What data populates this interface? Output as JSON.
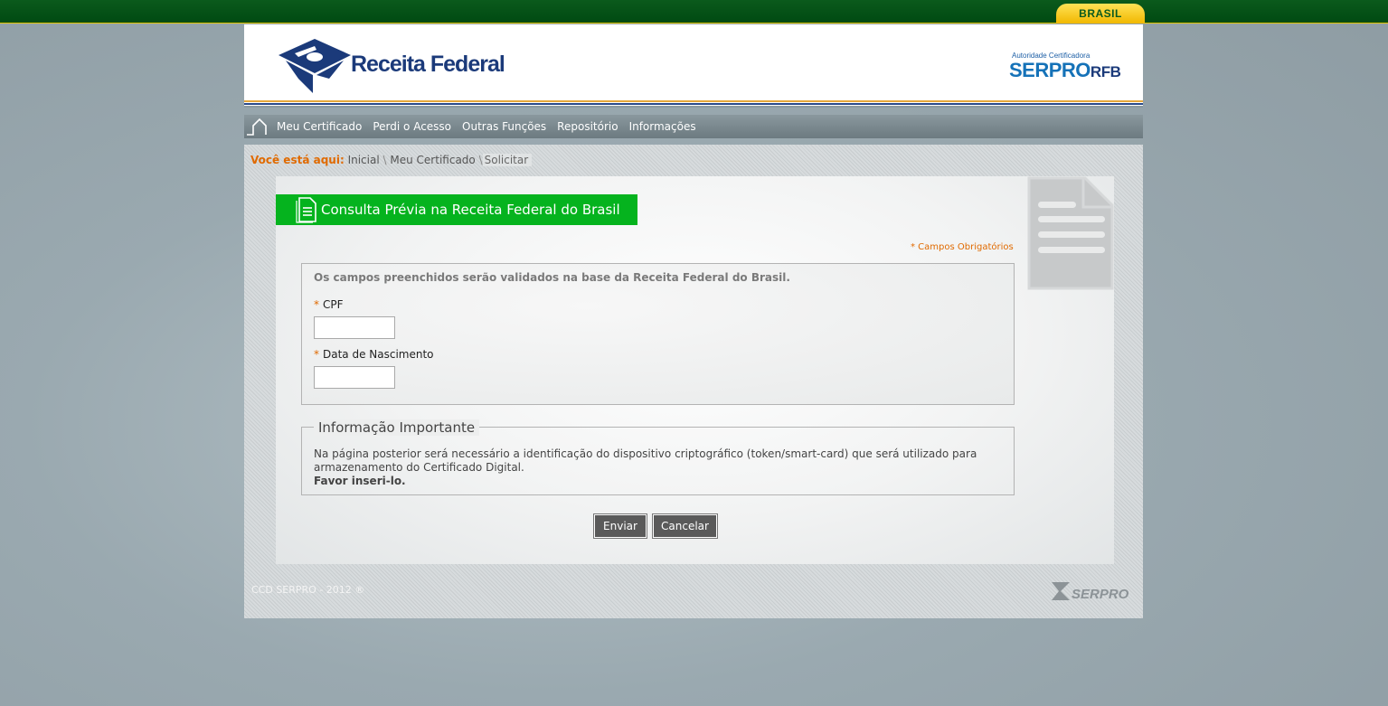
{
  "topbar": {
    "badge_text": "BRASIL"
  },
  "header": {
    "logo_text": "Receita Federal",
    "ac_label": "Autoridade Certificadora",
    "serpro_text": "SERPRO",
    "rfb_text": "RFB"
  },
  "nav": {
    "items": [
      {
        "label": "Meu Certificado"
      },
      {
        "label": "Perdi o Acesso"
      },
      {
        "label": "Outras Funções"
      },
      {
        "label": "Repositório"
      },
      {
        "label": "Informações"
      }
    ]
  },
  "breadcrumb": {
    "label": "Você está aqui:",
    "items": [
      "Inicial",
      "Meu Certificado",
      "Solicitar"
    ],
    "separator": "\\"
  },
  "form": {
    "title": "Consulta Prévia na Receita Federal do Brasil",
    "required_note": "* Campos Obrigatórios",
    "validation_note": "Os campos preenchidos serão validados na base da Receita Federal do Brasil.",
    "required_marker": "*",
    "fields": [
      {
        "label": "CPF",
        "value": ""
      },
      {
        "label": "Data de Nascimento",
        "value": ""
      }
    ]
  },
  "info": {
    "legend": "Informação Importante",
    "text": "Na página posterior será necessário a identificação do dispositivo criptográfico (token/smart-card) que será utilizado para armazenamento do Certificado Digital.",
    "strong": "Favor inseri-lo."
  },
  "buttons": {
    "submit": "Enviar",
    "cancel": "Cancelar"
  },
  "footer": {
    "copyright": "CCD SERPRO - 2012 ®",
    "logo_text": "SERPRO"
  },
  "colors": {
    "topbar": "#004a12",
    "title_bar": "#05b31e",
    "accent_orange": "#e06a00",
    "button": "#5a5a5a"
  },
  "icons": [
    "brasil-badge",
    "receita-federal-logo-icon",
    "home-icon",
    "document-icon",
    "serpro-logo-icon"
  ]
}
